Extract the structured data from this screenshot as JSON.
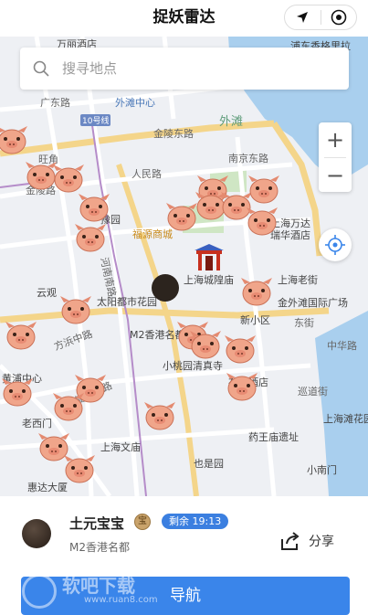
{
  "app": {
    "title": "捉妖雷达"
  },
  "search": {
    "placeholder": "搜寻地点"
  },
  "map": {
    "labels": [
      "万丽酒店",
      "浦东香格里拉",
      "广东路",
      "外滩中心",
      "10号线",
      "金陵东路",
      "外滩",
      "旺角",
      "金陵路",
      "南京东路",
      "人民路",
      "豫园",
      "福源商城",
      "上海万达",
      "瑞华酒店",
      "河南南路",
      "上海城隍庙",
      "上海老街",
      "云观",
      "太阳都市花园",
      "金外滩国际广场",
      "方浜中路",
      "M2香港名都",
      "新小区",
      "东街",
      "中华路",
      "小桃园清真寺",
      "布丁酒店",
      "巡道街",
      "黄浦中心",
      "复兴东路",
      "老西门",
      "上海文庙",
      "药王庙遗址",
      "上海滩花园",
      "也是园",
      "惠达大厦",
      "小南门"
    ]
  },
  "controls": {
    "zoom_in": "+",
    "zoom_out": "−"
  },
  "detail": {
    "name": "土元宝宝",
    "coin_glyph": "宝",
    "remain": "剩余 19:13",
    "location": "M2香港名都",
    "share_label": "分享"
  },
  "nav": {
    "label": "导航"
  },
  "watermark": {
    "main": "软吧下载",
    "url": "www.ruan8.com"
  },
  "icons": {
    "location-arrow": "location-arrow-icon",
    "target": "target-icon",
    "search": "search-icon",
    "locate": "crosshair-icon",
    "share": "share-icon"
  },
  "colors": {
    "accent": "#3a85ea",
    "remain_badge": "#3b7fe0",
    "river": "#a9cfee",
    "park": "#cfe6c4"
  }
}
